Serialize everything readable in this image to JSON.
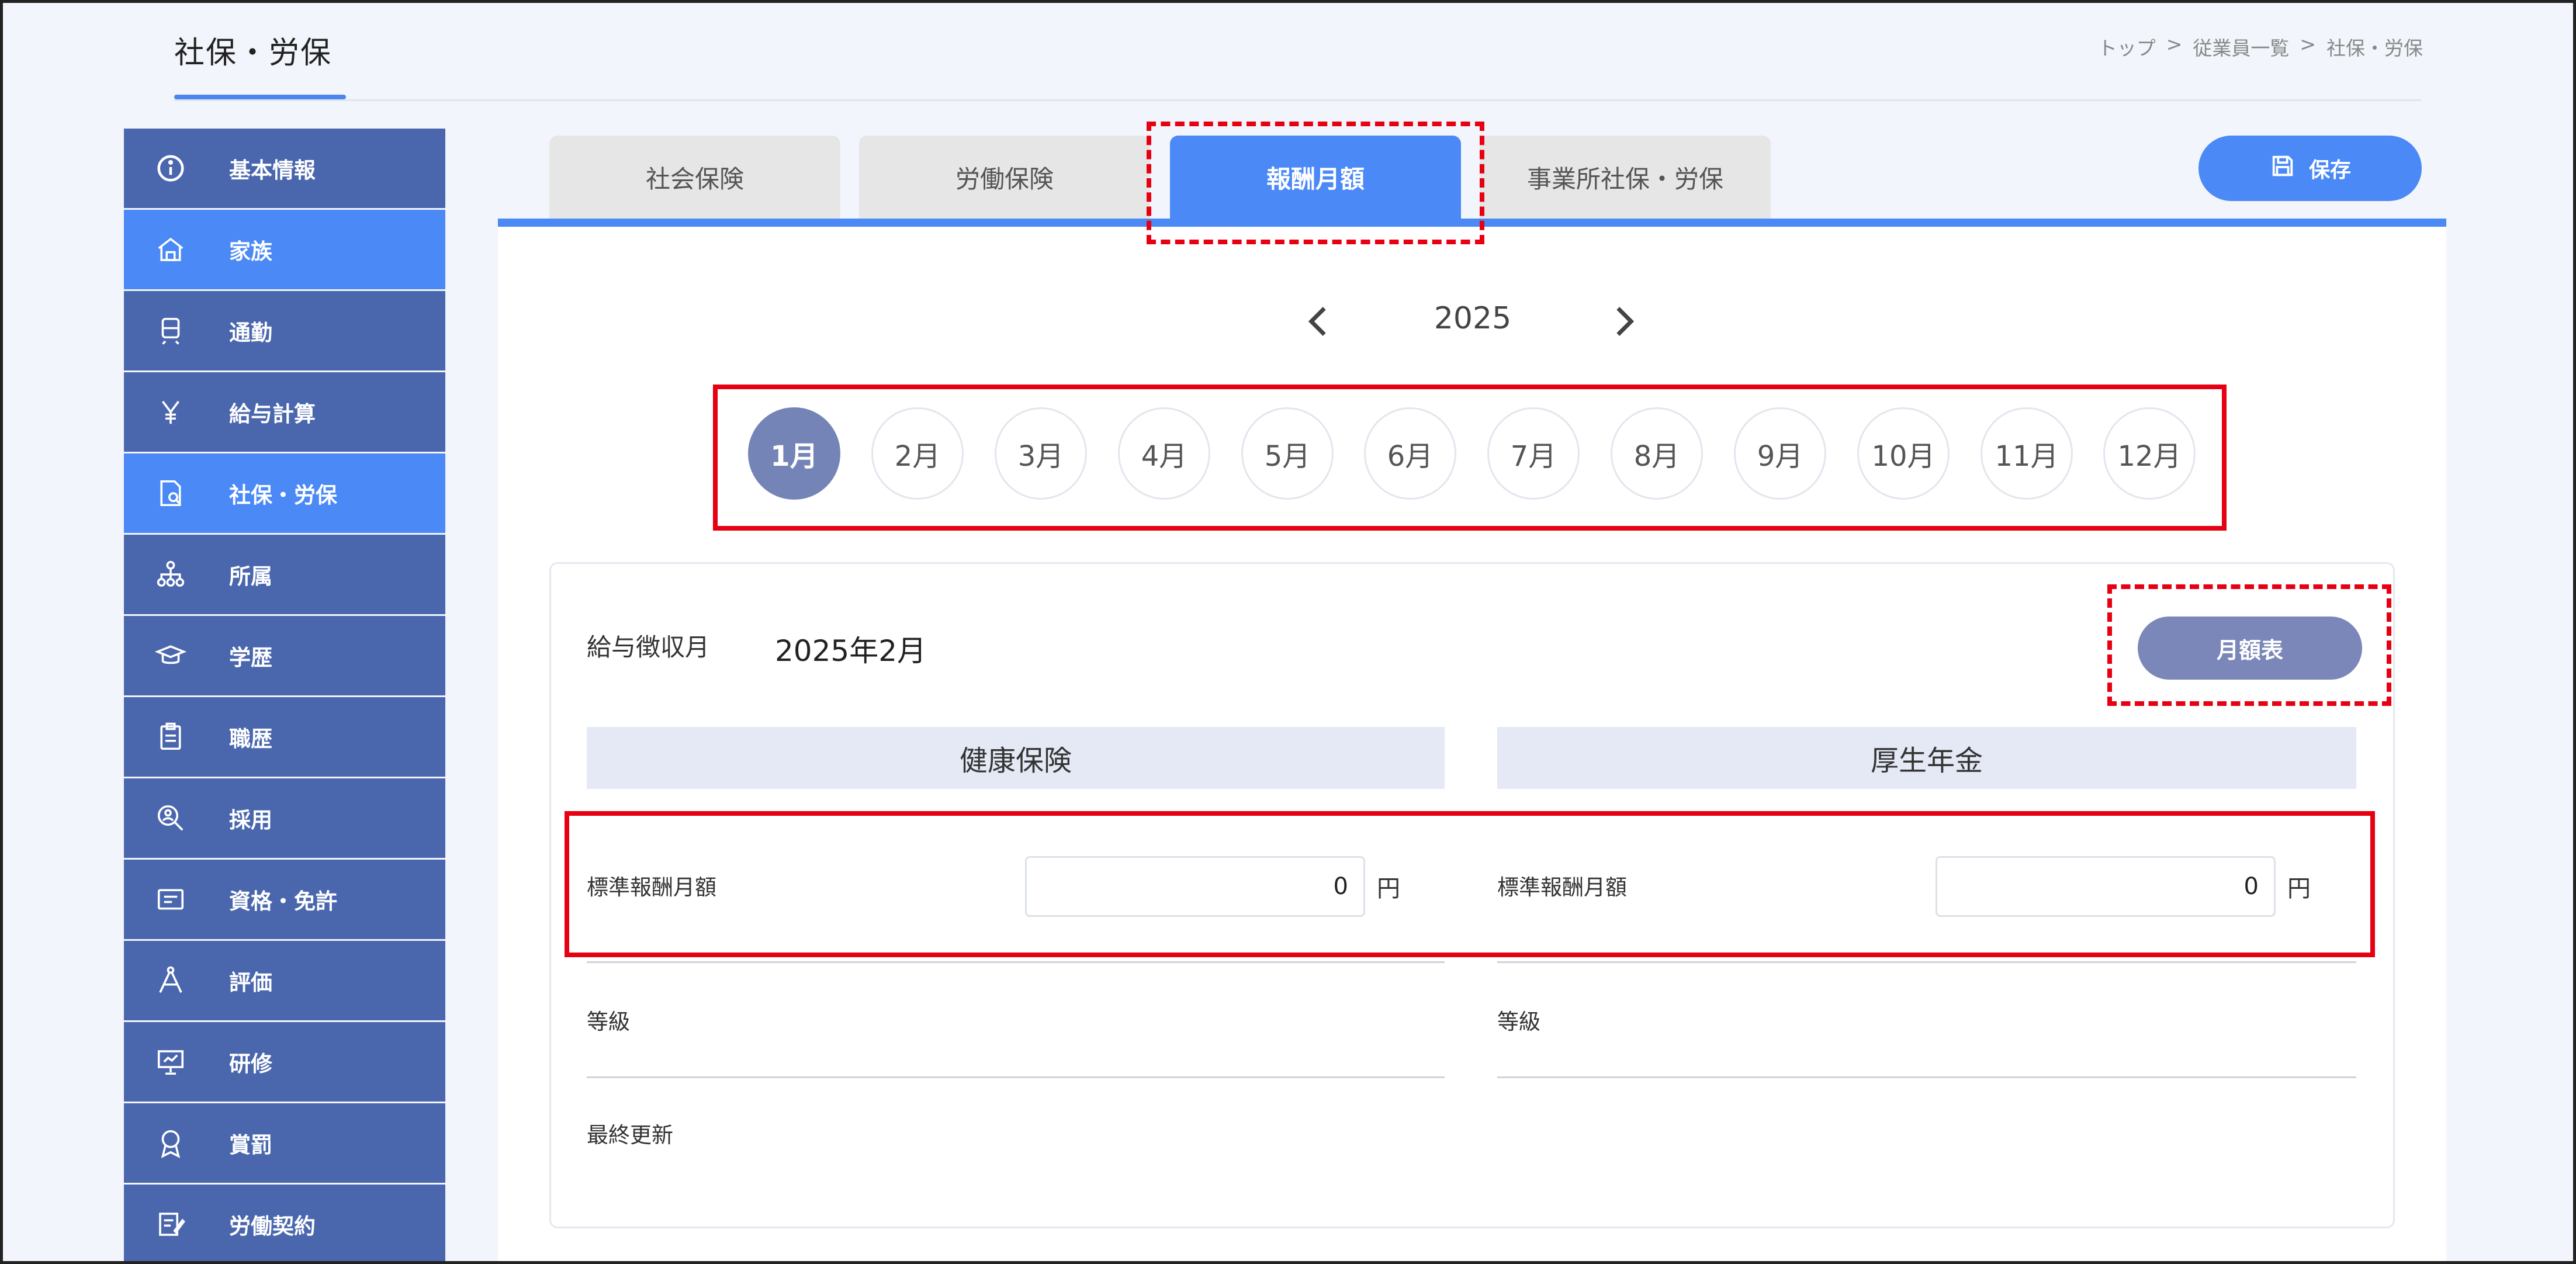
{
  "header": {
    "title": "社保・労保",
    "breadcrumb": [
      "トップ",
      ">",
      "従業員一覧",
      ">",
      "社保・労保"
    ]
  },
  "sidebar": {
    "items": [
      {
        "label": "基本情報",
        "icon": "info-icon",
        "active": false
      },
      {
        "label": "家族",
        "icon": "house-icon",
        "active": true
      },
      {
        "label": "通勤",
        "icon": "train-icon",
        "active": false
      },
      {
        "label": "給与計算",
        "icon": "yen-icon",
        "active": false
      },
      {
        "label": "社保・労保",
        "icon": "document-icon",
        "active": true
      },
      {
        "label": "所属",
        "icon": "org-chart-icon",
        "active": false
      },
      {
        "label": "学歴",
        "icon": "graduation-cap-icon",
        "active": false
      },
      {
        "label": "職歴",
        "icon": "clipboard-icon",
        "active": false
      },
      {
        "label": "採用",
        "icon": "magnifier-user-icon",
        "active": false
      },
      {
        "label": "資格・免許",
        "icon": "id-card-icon",
        "active": false
      },
      {
        "label": "評価",
        "icon": "compass-icon",
        "active": false
      },
      {
        "label": "研修",
        "icon": "presentation-icon",
        "active": false
      },
      {
        "label": "賞罰",
        "icon": "medal-icon",
        "active": false
      },
      {
        "label": "労働契約",
        "icon": "contract-icon",
        "active": false
      }
    ]
  },
  "tabs": [
    {
      "label": "社会保険",
      "active": false
    },
    {
      "label": "労働保険",
      "active": false
    },
    {
      "label": "報酬月額",
      "active": true
    },
    {
      "label": "事業所社保・労保",
      "active": false
    }
  ],
  "save_button": {
    "label": "保存",
    "icon": "save-icon"
  },
  "year_nav": {
    "year": "2025",
    "prev_icon": "chevron-left-icon",
    "next_icon": "chevron-right-icon"
  },
  "months": [
    {
      "label": "1月",
      "active": true
    },
    {
      "label": "2月",
      "active": false
    },
    {
      "label": "3月",
      "active": false
    },
    {
      "label": "4月",
      "active": false
    },
    {
      "label": "5月",
      "active": false
    },
    {
      "label": "6月",
      "active": false
    },
    {
      "label": "7月",
      "active": false
    },
    {
      "label": "8月",
      "active": false
    },
    {
      "label": "9月",
      "active": false
    },
    {
      "label": "10月",
      "active": false
    },
    {
      "label": "11月",
      "active": false
    },
    {
      "label": "12月",
      "active": false
    }
  ],
  "card": {
    "collect_label": "給与徴収月",
    "collect_value": "2025年2月",
    "monthly_table_button": "月額表",
    "health": {
      "title": "健康保険",
      "amount_label": "標準報酬月額",
      "amount_value": "0",
      "unit": "円",
      "grade_label": "等級"
    },
    "pension": {
      "title": "厚生年金",
      "amount_label": "標準報酬月額",
      "amount_value": "0",
      "unit": "円",
      "grade_label": "等級"
    },
    "last_updated_label": "最終更新"
  },
  "colors": {
    "primary": "#4a89f6",
    "sidebar": "#4a67ad",
    "month_active": "#7584b7",
    "annotation": "#e60012"
  }
}
